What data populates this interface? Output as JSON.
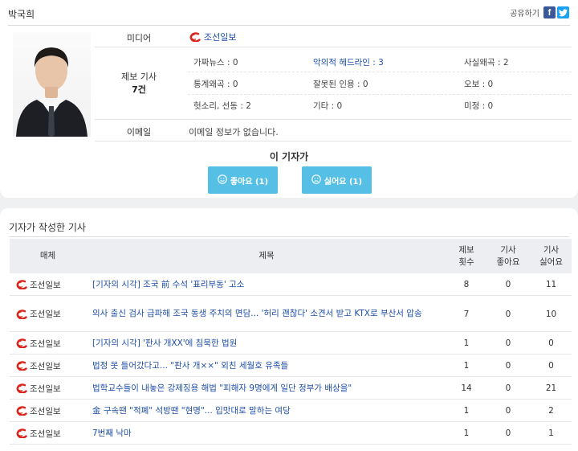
{
  "reporter": {
    "name": "박국희",
    "share_label": "공유하기",
    "share_icons": [
      "facebook-icon",
      "twitter-icon"
    ]
  },
  "profile": {
    "media_label": "미디어",
    "media_name": "조선일보",
    "report_label": "제보 기사",
    "report_count": "7건",
    "categories": [
      {
        "label": "가짜뉴스 : 0",
        "highlight": false
      },
      {
        "label": "악의적 헤드라인 : 3",
        "highlight": true
      },
      {
        "label": "사실왜곡 : 2",
        "highlight": false
      },
      {
        "label": "통계왜곡 : 0",
        "highlight": false
      },
      {
        "label": "잘못된 인용 : 0",
        "highlight": false
      },
      {
        "label": "오보 : 0",
        "highlight": false
      },
      {
        "label": "헛소리, 선동 : 2",
        "highlight": false
      },
      {
        "label": "기타 : 0",
        "highlight": false
      },
      {
        "label": "미정 : 0",
        "highlight": false
      }
    ],
    "email_label": "이메일",
    "email_value": "이메일 정보가 없습니다.",
    "reaction_title": "이 기자가",
    "like_label": "좋아요 (1)",
    "dislike_label": "싫어요 (1)"
  },
  "articles": {
    "section_title": "기자가 작성한 기사",
    "headers": {
      "media": "매체",
      "title": "제목",
      "count": "제보\n횟수",
      "like": "기사\n좋아요",
      "dislike": "기사\n싫어요"
    },
    "rows": [
      {
        "media": "조선일보",
        "title": "[기자의 시각] 조국 前 수석 '표리부동' 고소",
        "count": "8",
        "like": "0",
        "dislike": "11"
      },
      {
        "media": "조선일보",
        "title": "의사 출신 검사 급파해 조국 동생 주치의 면담... '허리 괜찮다' 소견서 받고 KTX로 부산서 압송",
        "count": "7",
        "like": "0",
        "dislike": "10"
      },
      {
        "media": "조선일보",
        "title": "[기자의 시각] '판사 개XX'에 침묵한 법원",
        "count": "1",
        "like": "0",
        "dislike": "0"
      },
      {
        "media": "조선일보",
        "title": "법정 못 들어갔다고... \"판사 개××\" 외친 세월호 유족들",
        "count": "1",
        "like": "0",
        "dislike": "0"
      },
      {
        "media": "조선일보",
        "title": "법학교수들이 내놓은 강제징용 해법 \"피해자 9명에게 일단 정부가 배상을\"",
        "count": "14",
        "like": "0",
        "dislike": "21"
      },
      {
        "media": "조선일보",
        "title": "金 구속땐 \"적폐\" 석방땐 \"현명\"... 입맛대로 말하는 여당",
        "count": "1",
        "like": "0",
        "dislike": "2"
      },
      {
        "media": "조선일보",
        "title": "7번째 낙마",
        "count": "1",
        "like": "0",
        "dislike": "1"
      }
    ]
  },
  "colors": {
    "accent_blue": "#1f4fa8",
    "button_blue": "#56bfe6",
    "logo_red": "#d9241b"
  }
}
